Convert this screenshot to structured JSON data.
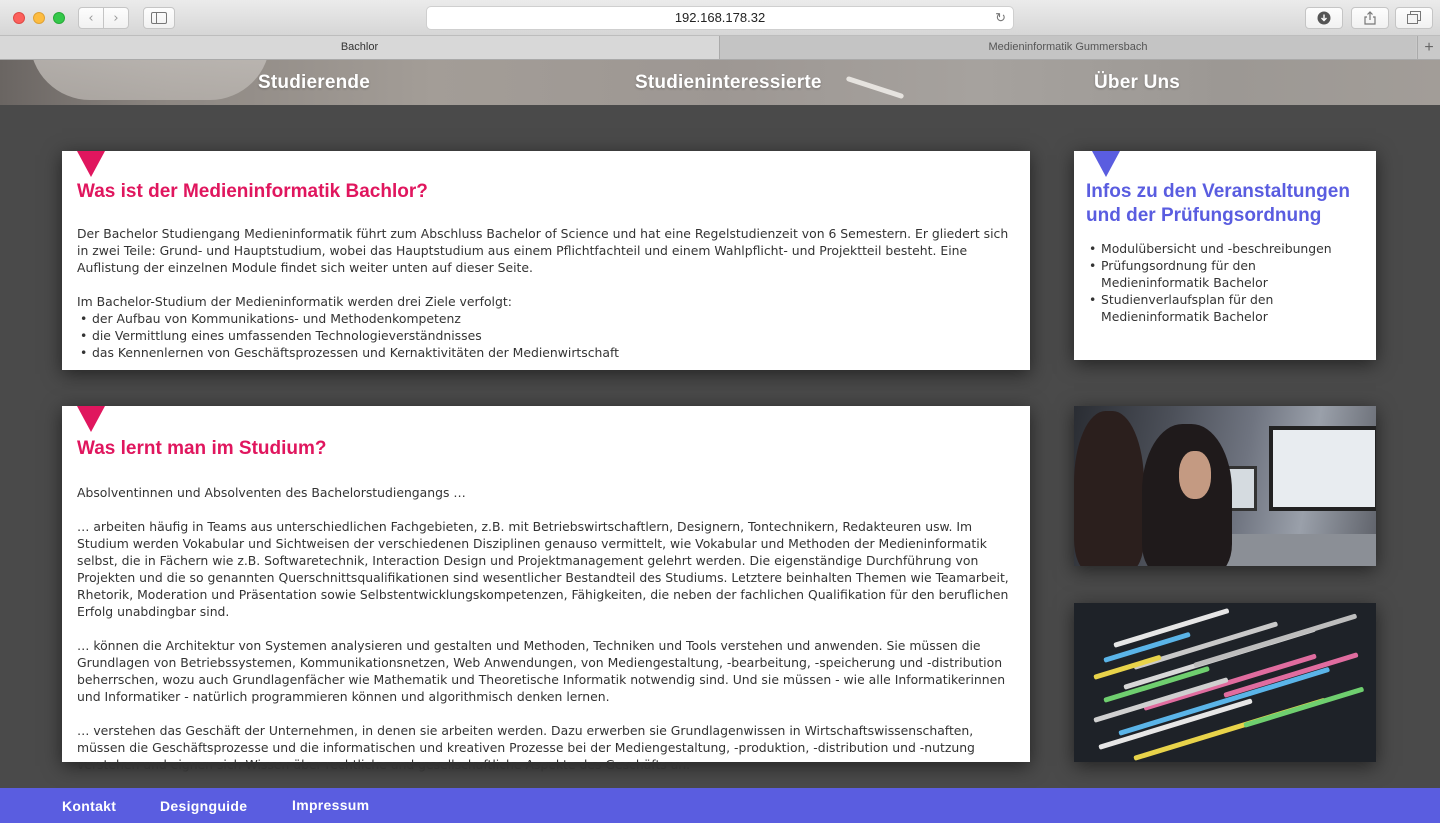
{
  "browser": {
    "url": "192.168.178.32",
    "tabs": [
      {
        "label": "Bachlor",
        "active": true
      },
      {
        "label": "Medieninformatik Gummersbach",
        "active": false
      }
    ],
    "icons": {
      "back": "chevron-left-icon",
      "forward": "chevron-right-icon",
      "sidebar": "sidebar-icon",
      "reload": "reload-icon",
      "download": "download-icon",
      "share": "share-icon",
      "tabs": "tabs-icon",
      "new_tab": "plus-icon"
    }
  },
  "nav": {
    "items": [
      "Studierende",
      "Studieninteressierte",
      "Über Uns"
    ]
  },
  "colors": {
    "accent_pink": "#e0165e",
    "accent_blue": "#5a5de0",
    "page_background": "#4a4a4a"
  },
  "section_bachelor": {
    "title": "Was ist der Medieninformatik Bachlor?",
    "intro": "Der Bachelor Studiengang Medieninformatik führt zum Abschluss Bachelor of Science und hat eine Regelstudienzeit von 6 Semestern. Er gliedert sich in zwei Teile: Grund- und Hauptstudium, wobei das Hauptstudium aus einem Pflichtfachteil und einem Wahlpflicht- und Projektteil besteht. Eine Auflistung der einzelnen Module findet sich weiter unten auf dieser Seite.",
    "goals_intro": "Im Bachelor-Studium der Medieninformatik werden drei Ziele verfolgt:",
    "goals": [
      "der Aufbau von Kommunikations- und Methodenkompetenz",
      "die Vermittlung eines umfassenden Technologieverständnisses",
      "das Kennenlernen von Geschäftsprozessen und Kernaktivitäten der Medienwirtschaft"
    ]
  },
  "section_infos": {
    "title": "Infos zu den Veranstaltungen und der Prüfungsordnung",
    "items": [
      "Modulübersicht und -beschreibungen",
      "Prüfungsordnung für den Medieninformatik Bachelor",
      "Studienverlaufsplan für den Medieninformatik Bachelor"
    ]
  },
  "section_study": {
    "title": "Was lernt man im Studium?",
    "paragraphs": [
      "Absolventinnen und Absolventen des Bachelorstudiengangs …",
      "… arbeiten häufig in Teams aus unterschiedlichen Fachgebieten, z.B. mit Betriebswirtschaftlern, Designern, Tontechnikern, Redakteuren usw. Im Studium werden Vokabular und Sichtweisen der verschiedenen Disziplinen genauso vermittelt, wie Vokabular und Methoden der Medieninformatik selbst, die in Fächern wie z.B. Softwaretechnik, Interaction Design und Projektmanagement gelehrt werden. Die eigenständige Durchführung von Projekten und die so genannten Querschnittsqualifikationen sind wesentlicher Bestandteil des Studiums. Letztere beinhalten Themen wie Teamarbeit, Rhetorik, Moderation und Präsentation sowie Selbstentwicklungskompetenzen, Fähigkeiten, die neben der fachlichen Qualifikation für den beruflichen Erfolg unabdingbar sind.",
      "… können die Architektur von Systemen analysieren und gestalten und Methoden, Techniken und Tools verstehen und anwenden. Sie müssen die Grundlagen von Betriebssystemen, Kommunikationsnetzen, Web Anwendungen, von Mediengestaltung, -bearbeitung, -speicherung und -distribution beherrschen, wozu auch Grundlagenfächer wie Mathematik und Theoretische Informatik notwendig sind. Und sie müssen - wie alle Informatikerinnen und Informatiker - natürlich programmieren können und algorithmisch denken lernen.",
      "… verstehen das Geschäft der Unternehmen, in denen sie arbeiten werden. Dazu erwerben sie Grundlagenwissen in Wirtschaftswissenschaften, müssen die Geschäftsprozesse und die informatischen und kreativen Prozesse bei der Mediengestaltung, -produktion, -distribution und -nutzung verstehen und eignen sich Wissen über rechtliche und gesellschaftliche Aspekte des Geschäfts an."
    ]
  },
  "images": {
    "students_photo": "students-at-computers-photo",
    "code_photo": "source-code-screen-photo"
  },
  "footer": {
    "links": [
      "Kontakt",
      "Designguide",
      "Impressum"
    ]
  }
}
